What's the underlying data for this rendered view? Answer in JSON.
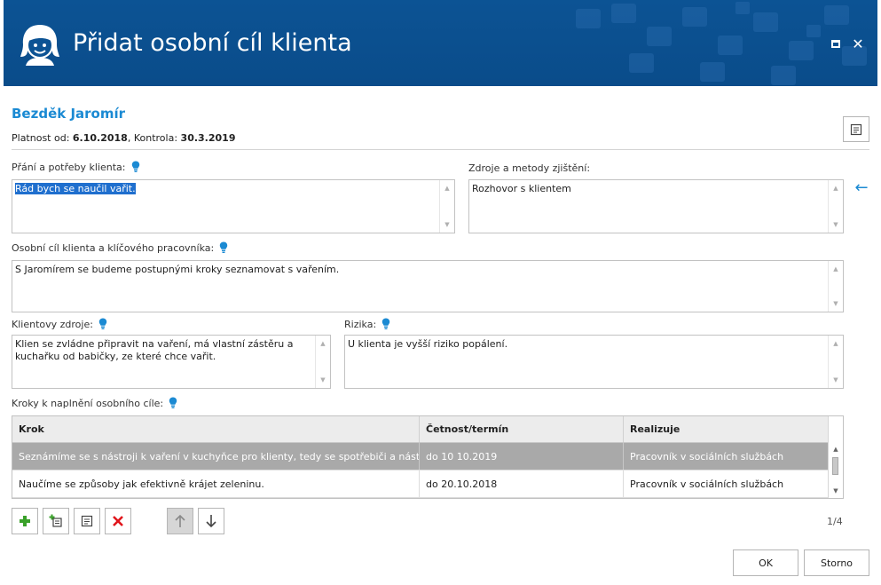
{
  "window": {
    "title": "Přidat osobní cíl klienta"
  },
  "client": {
    "name": "Bezděk Jaromír",
    "validity_label": "Platnost od:",
    "validity_from": "6.10.2018",
    "check_label": "Kontrola:",
    "check_date": "30.3.2019"
  },
  "fields": {
    "wishes_label": "Přání a potřeby klienta:",
    "wishes_value": "Rád bych se naučil vařit.",
    "sources_label": "Zdroje a metody zjištění:",
    "sources_value": "Rozhovor s klientem",
    "goal_label": "Osobní cíl klienta a klíčového pracovníka:",
    "goal_value": "S Jaromírem se budeme postupnými kroky seznamovat s vařením.",
    "resources_label": "Klientovy zdroje:",
    "resources_value": "Klien se zvládne připravit na vaření, má vlastní zástěru a kuchařku od babičky, ze které chce vařit.",
    "risks_label": "Rizika:",
    "risks_value": "U klienta je vyšší riziko popálení.",
    "steps_label": "Kroky k naplnění osobního cíle:"
  },
  "steps_table": {
    "columns": [
      "Krok",
      "Četnost/termín",
      "Realizuje"
    ],
    "rows": [
      [
        "Seznámíme se s nástroji k vaření v kuchyňce pro klienty, tedy se spotřebiči a nástroji ke...",
        "do 10 10.2019",
        "Pracovník v sociálních službách"
      ],
      [
        "Naučíme se způsoby jak efektivně krájet zeleninu.",
        "do 20.10.2018",
        "Pracovník v sociálních službách"
      ]
    ],
    "selected_row": 0,
    "pager": "1/4"
  },
  "buttons": {
    "ok": "OK",
    "cancel": "Storno"
  },
  "colors": {
    "titlebar": "#0c5394",
    "accent": "#1b8ad3",
    "selected_row": "#a9a9a9",
    "add_icon": "#3aa12a",
    "delete_icon": "#e0141b"
  },
  "icons": {
    "title": "client-avatar-icon",
    "maximize": "maximize-icon",
    "close": "close-icon",
    "notes": "notes-icon",
    "hint": "lightbulb-icon",
    "back": "arrow-left-icon",
    "add": "plus-icon",
    "add_sub": "add-subitem-icon",
    "edit": "edit-icon",
    "delete": "delete-icon",
    "move_up": "arrow-up-icon",
    "move_down": "arrow-down-icon"
  }
}
